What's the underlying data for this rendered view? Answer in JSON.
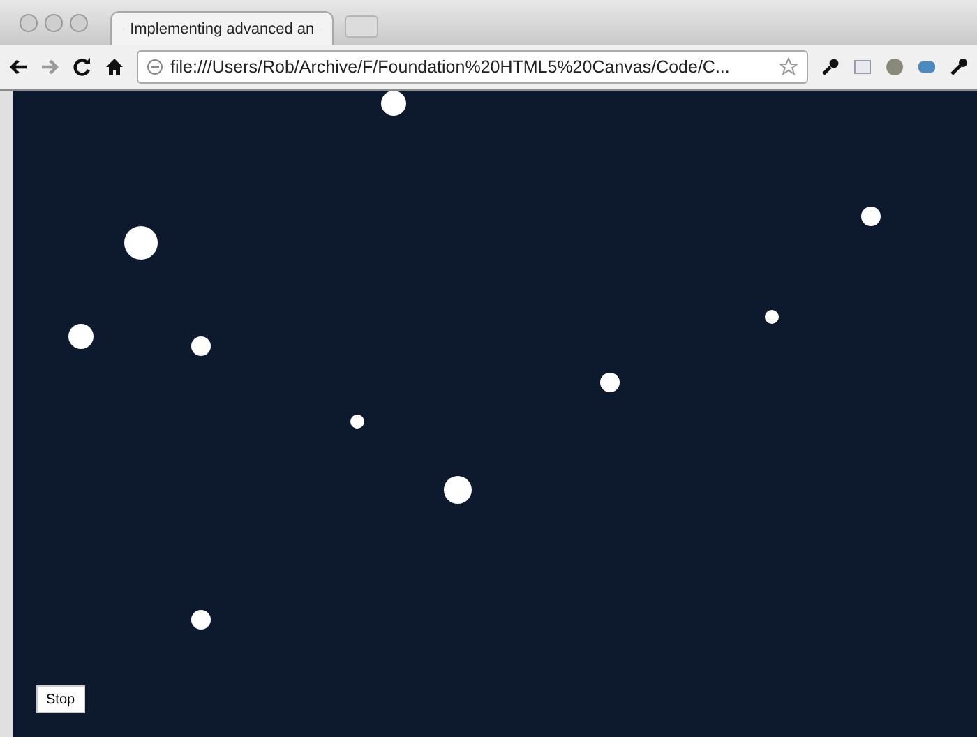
{
  "tab": {
    "title": "Implementing advanced an",
    "selected": true
  },
  "address_bar": {
    "value": "file:///Users/Rob/Archive/F/Foundation%20HTML5%20Canvas/Code/C..."
  },
  "page": {
    "button": "Stop"
  }
}
